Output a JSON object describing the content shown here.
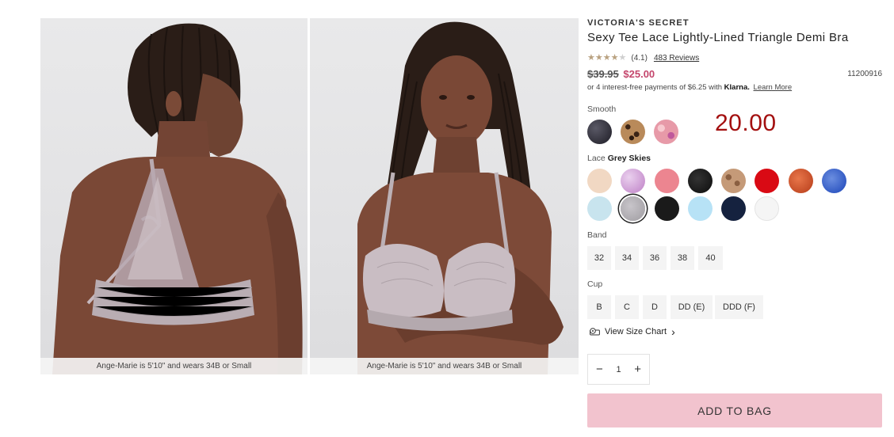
{
  "images": [
    {
      "caption": "Ange-Marie is 5'10\" and wears 34B or Small"
    },
    {
      "caption": "Ange-Marie is 5'10\" and wears 34B or Small"
    }
  ],
  "product": {
    "brand": "VICTORIA'S SECRET",
    "title": "Sexy Tee Lace Lightly-Lined Triangle Demi Bra",
    "rating_value": "(4.1)",
    "rating_stars": 4.1,
    "reviews_label": "483 Reviews",
    "original_price": "$39.95",
    "sale_price": "$25.00",
    "sku": "11200916",
    "klarna_text": "or 4 interest-free payments of $6.25 with",
    "klarna_logo": "Klarna.",
    "learn_more": "Learn More"
  },
  "overlay_price": "20.00",
  "smooth": {
    "label": "Smooth",
    "swatches": [
      {
        "name": "black-marble",
        "color": "#3b3a45"
      },
      {
        "name": "leopard",
        "color": "#6b4a2e"
      },
      {
        "name": "pink-floral",
        "color": "#e79aa8"
      }
    ]
  },
  "lace": {
    "label": "Lace",
    "selected_color": "Grey Skies",
    "swatches_row1": [
      {
        "name": "beige",
        "color": "#f1d8c3"
      },
      {
        "name": "lilac",
        "color": "#d4a9d8"
      },
      {
        "name": "coral-pink",
        "color": "#ec8590"
      },
      {
        "name": "black",
        "color": "#1e1e1e"
      },
      {
        "name": "mocha-leopard",
        "color": "#b68663"
      },
      {
        "name": "red",
        "color": "#d90a14"
      },
      {
        "name": "burnt-orange",
        "color": "#d5582f"
      },
      {
        "name": "royal-blue",
        "color": "#3f6ad0"
      }
    ],
    "swatches_row2": [
      {
        "name": "light-blue",
        "color": "#c8e4ee"
      },
      {
        "name": "grey-skies",
        "color": "#b4b1b6"
      },
      {
        "name": "black-lace",
        "color": "#1a1a1a"
      },
      {
        "name": "sky-blue",
        "color": "#b7e2f6"
      },
      {
        "name": "navy",
        "color": "#15223f"
      },
      {
        "name": "white",
        "color": "#f5f5f5"
      }
    ]
  },
  "band": {
    "label": "Band",
    "options": [
      "32",
      "34",
      "36",
      "38",
      "40"
    ]
  },
  "cup": {
    "label": "Cup",
    "options": [
      "B",
      "C",
      "D",
      "DD (E)",
      "DDD (F)"
    ]
  },
  "size_chart": {
    "label": "View Size Chart",
    "arrow": "›"
  },
  "quantity": {
    "minus": "−",
    "value": "1",
    "plus": "+"
  },
  "add_to_bag": "ADD TO BAG"
}
